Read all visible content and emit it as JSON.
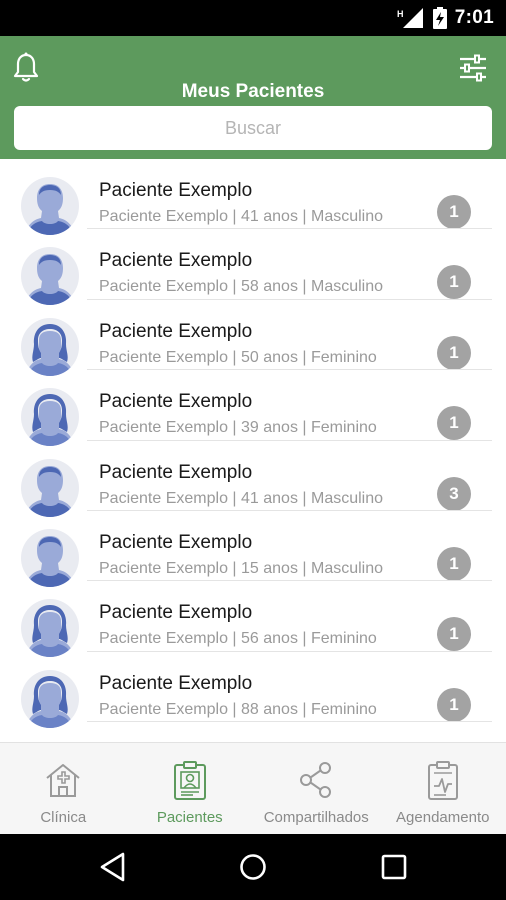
{
  "status_bar": {
    "time": "7:01"
  },
  "header": {
    "title": "Meus Pacientes",
    "search_placeholder": "Buscar",
    "accent_color": "#5d9a5d"
  },
  "patients": [
    {
      "name": "Paciente Exemplo",
      "details": "Paciente Exemplo | 41 anos | Masculino",
      "badge": "1",
      "avatar": "male-avatar-icon"
    },
    {
      "name": "Paciente Exemplo",
      "details": "Paciente Exemplo | 58 anos | Masculino",
      "badge": "1",
      "avatar": "male-avatar-icon"
    },
    {
      "name": "Paciente Exemplo",
      "details": "Paciente Exemplo | 50 anos | Feminino",
      "badge": "1",
      "avatar": "female-avatar-icon"
    },
    {
      "name": "Paciente Exemplo",
      "details": "Paciente Exemplo | 39 anos | Feminino",
      "badge": "1",
      "avatar": "female-avatar-icon"
    },
    {
      "name": "Paciente Exemplo",
      "details": "Paciente Exemplo | 41 anos | Masculino",
      "badge": "3",
      "avatar": "male-avatar-icon"
    },
    {
      "name": "Paciente Exemplo",
      "details": "Paciente Exemplo | 15 anos | Masculino",
      "badge": "1",
      "avatar": "male-avatar-icon"
    },
    {
      "name": "Paciente Exemplo",
      "details": "Paciente Exemplo | 56 anos | Feminino",
      "badge": "1",
      "avatar": "female-avatar-icon"
    },
    {
      "name": "Paciente Exemplo",
      "details": "Paciente Exemplo | 88 anos | Feminino",
      "badge": "1",
      "avatar": "female-avatar-icon"
    }
  ],
  "bottom_nav": [
    {
      "label": "Clínica",
      "icon": "clinic-icon",
      "active": false
    },
    {
      "label": "Pacientes",
      "icon": "patient-card-icon",
      "active": true
    },
    {
      "label": "Compartilhados",
      "icon": "share-icon",
      "active": false
    },
    {
      "label": "Agendamento",
      "icon": "clipboard-icon",
      "active": false
    }
  ]
}
